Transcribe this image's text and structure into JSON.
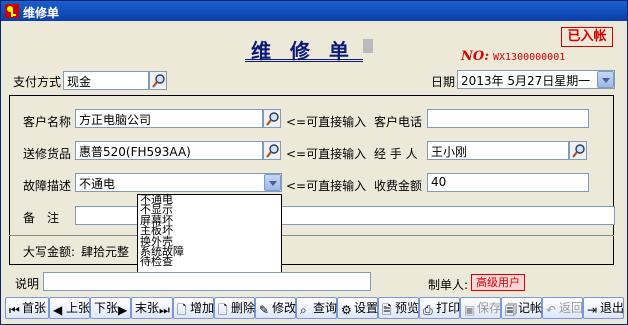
{
  "window": {
    "title": "维修单"
  },
  "header": {
    "title": "维 修 单",
    "stamp": "已入帐",
    "no_label": "NO:",
    "no_value": "WX1300000001"
  },
  "top": {
    "pay_label": "支付方式",
    "pay_value": "现金",
    "date_label": "日期",
    "date_value": "2013年 5月27日星期一"
  },
  "form": {
    "customer_label": "客户名称",
    "customer_value": "方正电脑公司",
    "customer_hint": "<=可直接输入",
    "phone_label": "客户电话",
    "phone_value": "",
    "goods_label": "送修货品",
    "goods_value": "惠普520(FH593AA)",
    "goods_hint": "<=可直接输入",
    "handler_label": "经 手 人",
    "handler_value": "王小刚",
    "fault_label": "故障描述",
    "fault_value": "不通电",
    "fault_hint": "<=可直接输入",
    "fee_label": "收费金额",
    "fee_value": "40",
    "remark_label": "备　注",
    "remark_value": "",
    "amount_label": "大写金额:",
    "amount_value": "肆拾元整"
  },
  "fault_options": [
    "不通电",
    "不显示",
    "屏幕坏",
    "主板坏",
    "换外壳",
    "系统故障",
    "待检查"
  ],
  "footer": {
    "note_label": "说明",
    "note_value": "",
    "maker_label": "制单人:",
    "maker_value": "高级用户"
  },
  "toolbar": {
    "first": "首张",
    "prev": "上张",
    "next": "下张",
    "last": "末张",
    "add": "增加",
    "del": "删除",
    "edit": "修改",
    "query": "查询",
    "settings": "设置",
    "preview": "预览",
    "print": "打印",
    "save": "保存",
    "post": "记帐",
    "back": "返回",
    "exit": "退出"
  },
  "colors": {
    "title_blue": "#0a1a7a",
    "stamp_red": "#dd0000",
    "bar": "#0a3fa8"
  }
}
